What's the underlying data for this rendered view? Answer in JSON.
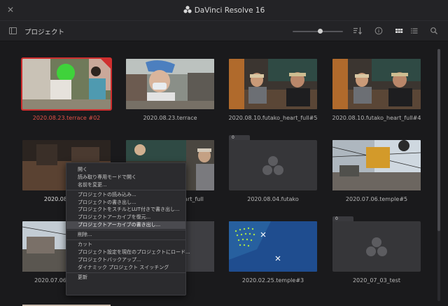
{
  "app": {
    "title": "DaVinci Resolve 16"
  },
  "toolbar": {
    "title": "プロジェクト"
  },
  "projects": [
    {
      "label": "2020.08.23.terrace #02",
      "selected": true,
      "kind": "image"
    },
    {
      "label": "2020.08.23.terrace",
      "selected": false,
      "kind": "image"
    },
    {
      "label": "2020.08.10.futako_heart_full#5",
      "selected": false,
      "kind": "image"
    },
    {
      "label": "2020.08.10.futako_heart_full#4",
      "selected": false,
      "kind": "image"
    },
    {
      "label": "2020.08.10.futa",
      "selected": false,
      "kind": "image"
    },
    {
      "label": "_heart_full",
      "selected": false,
      "kind": "image"
    },
    {
      "label": "2020.08.04.futako",
      "selected": false,
      "kind": "folder",
      "count": "0"
    },
    {
      "label": "2020.07.06.temple#5",
      "selected": false,
      "kind": "image"
    },
    {
      "label": "2020.07.06",
      "selected": false,
      "kind": "image"
    },
    {
      "label": "le#1",
      "selected": false,
      "kind": "image"
    },
    {
      "label": "2020.02.25.temple#3",
      "selected": false,
      "kind": "image"
    },
    {
      "label": "2020_07_03_test",
      "selected": false,
      "kind": "folder",
      "count": "0"
    }
  ],
  "context_menu": {
    "groups": [
      [
        "開く",
        "読み取り専用モードで開く",
        "名前を変更..."
      ],
      [
        "プロジェクトの読み込み...",
        "プロジェクトの書き出し...",
        "プロジェクトをスチルとLUT付きで書き出し...",
        "プロジェクトアーカイブを復元...",
        "プロジェクトアーカイブの書き出し..."
      ],
      [
        "削除..."
      ],
      [
        "カット",
        "プロジェクト設定を現在のプロジェクトにロード...",
        "プロジェクトバックアップ...",
        "ダイナミック プロジェクト スイッチング"
      ],
      [
        "更新"
      ]
    ],
    "highlighted": "プロジェクトアーカイブの書き出し..."
  }
}
